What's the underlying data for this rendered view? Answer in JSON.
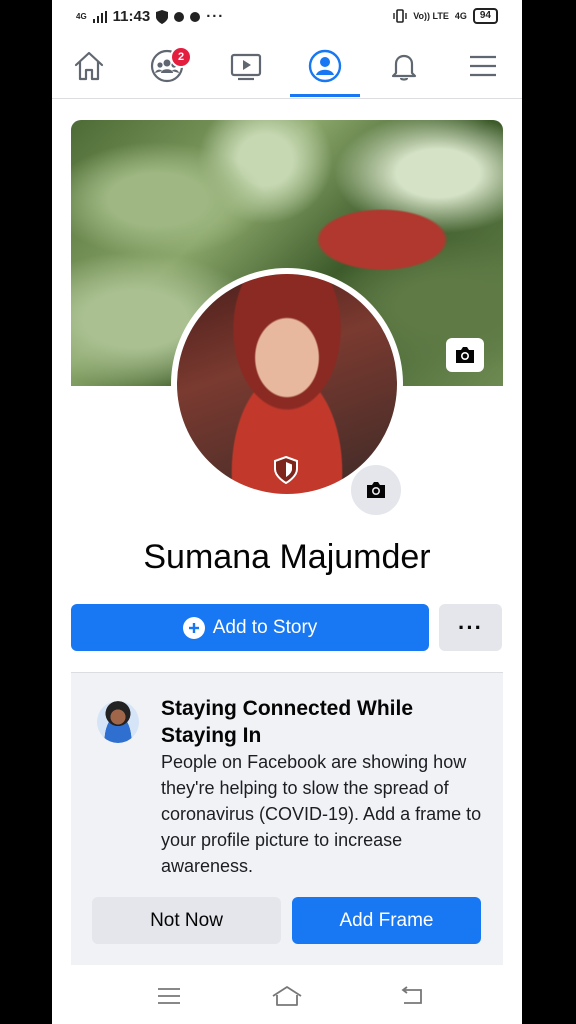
{
  "status_bar": {
    "network_label": "4G",
    "time": "11:43",
    "more": "···",
    "volte": "Vo)) LTE",
    "network_right": "4G",
    "battery": "94"
  },
  "nav": {
    "items": [
      {
        "name": "home"
      },
      {
        "name": "groups",
        "badge": "2"
      },
      {
        "name": "watch"
      },
      {
        "name": "profile",
        "active": true
      },
      {
        "name": "notifications"
      },
      {
        "name": "menu"
      }
    ],
    "accent_color": "#1877f2",
    "badge_color": "#e41e3f"
  },
  "profile": {
    "name": "Sumana Majumder",
    "add_story_label": "Add to Story",
    "more_label": "···"
  },
  "card": {
    "title": "Staying Connected While Staying In",
    "body": "People on Facebook are showing how they're helping to slow the spread of coronavirus (COVID-19). Add a frame to your profile picture to increase awareness.",
    "not_now_label": "Not Now",
    "add_frame_label": "Add Frame"
  }
}
